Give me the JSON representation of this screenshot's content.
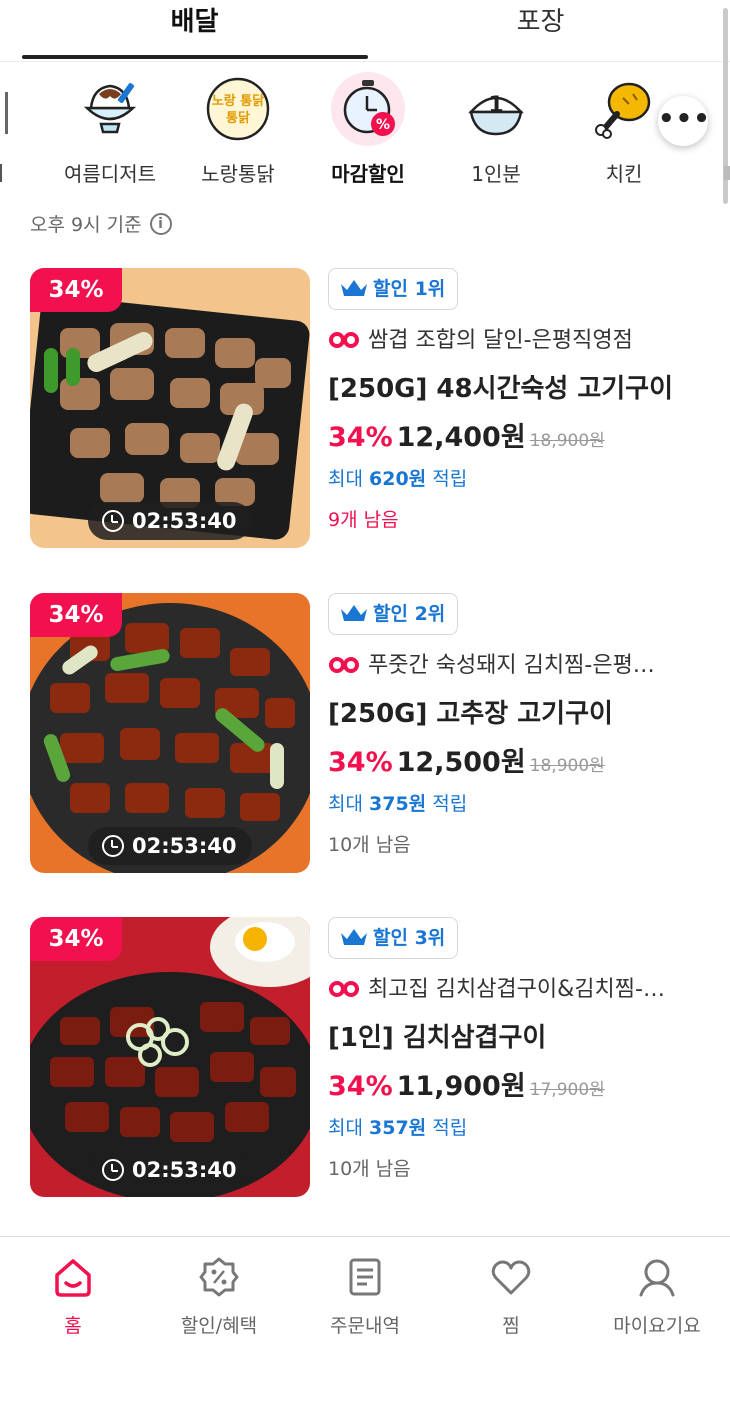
{
  "top_tabs": [
    {
      "label": "배달",
      "active": true
    },
    {
      "label": "포장",
      "active": false
    }
  ],
  "categories": [
    {
      "label": "여름디저트",
      "icon": "bingsu-icon"
    },
    {
      "label": "노랑통닭",
      "icon": "norang-logo-icon",
      "logo_text": "노랑 통닭"
    },
    {
      "label": "마감할인",
      "icon": "stopwatch-discount-icon",
      "active": true
    },
    {
      "label": "1인분",
      "icon": "rice-bowl-icon"
    },
    {
      "label": "치킨",
      "icon": "chicken-leg-icon"
    }
  ],
  "more_button": "•••",
  "time_note": "오후 9시 기준",
  "products": [
    {
      "discount_badge": "34%",
      "timer": "02:53:40",
      "rank_label": "할인 1위",
      "store": "쌈겹 조합의 달인-은평직영점",
      "name": "[250G] 48시간숙성 고기구이",
      "discount": "34%",
      "price": "12,400원",
      "original_price": "18,900원",
      "points_prefix": "최대",
      "points": "620원",
      "points_suffix": "적립",
      "remaining": "9개 남음",
      "remaining_hot": true
    },
    {
      "discount_badge": "34%",
      "timer": "02:53:40",
      "rank_label": "할인 2위",
      "store": "푸줏간 숙성돼지 김치찜-은평…",
      "name": "[250G] 고추장 고기구이",
      "discount": "34%",
      "price": "12,500원",
      "original_price": "18,900원",
      "points_prefix": "최대",
      "points": "375원",
      "points_suffix": "적립",
      "remaining": "10개 남음",
      "remaining_hot": false
    },
    {
      "discount_badge": "34%",
      "timer": "02:53:40",
      "rank_label": "할인 3위",
      "store": "최고집 김치삼겹구이&김치찜-…",
      "name": "[1인] 김치삼겹구이",
      "discount": "34%",
      "price": "11,900원",
      "original_price": "17,900원",
      "points_prefix": "최대",
      "points": "357원",
      "points_suffix": "적립",
      "remaining": "10개 남음",
      "remaining_hot": false
    }
  ],
  "bottom_nav": [
    {
      "label": "홈",
      "icon": "home-icon",
      "active": true
    },
    {
      "label": "할인/혜택",
      "icon": "discount-tag-icon"
    },
    {
      "label": "주문내역",
      "icon": "receipt-icon"
    },
    {
      "label": "찜",
      "icon": "heart-icon"
    },
    {
      "label": "마이요기요",
      "icon": "profile-icon"
    }
  ],
  "colors": {
    "accent": "#f2104f",
    "blue": "#1976d2",
    "text": "#222222"
  }
}
